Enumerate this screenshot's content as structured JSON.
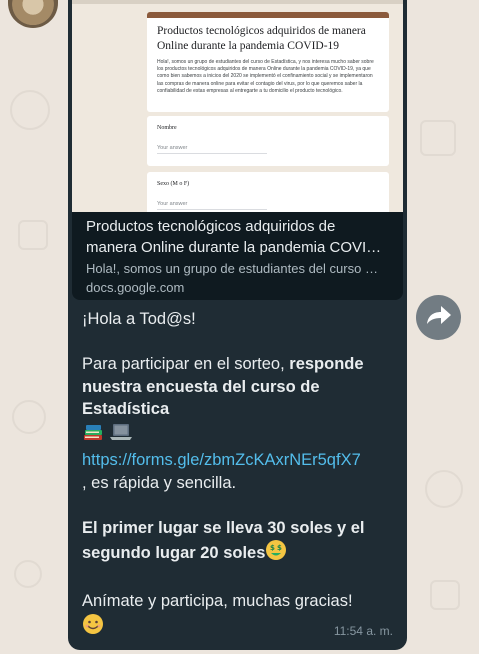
{
  "preview": {
    "form_title": "Productos tecnológicos adquiridos de manera Online durante la pandemia COVID-19",
    "form_description": "Hola!, somos un grupo de estudiantes del curso de Estadística, y nos interesa mucho saber sobre los productos tecnológicos adquiridos de manera Online durante la pandemia COVID-19, ya que como bien sabemos a inicios del 2020 se implementó el confinamiento social y se implementaron las compras de manera online para evitar el contagio del virus, por lo que queremos saber la confiabilidad de estas empresas al entregarte a tu domicilio el producto tecnológico.",
    "questions": [
      {
        "label": "Nombre",
        "answer_placeholder": "Your answer"
      },
      {
        "label": "Sexo (M o F)",
        "answer_placeholder": "Your answer"
      }
    ],
    "title_line1": "Productos tecnológicos adquiridos de",
    "title_line2": "manera Online durante la pandemia COVI…",
    "description": "Hola!, somos un grupo de estudiantes del curso …",
    "domain": "docs.google.com"
  },
  "message": {
    "greeting": "¡Hola a Tod@s!",
    "participate_prefix": "Para participar en el sorteo, ",
    "participate_bold": "responde nuestra encuesta del curso de Estadística",
    "link": "https://forms.gle/zbmZcKAxrNEr5qfX7",
    "link_suffix": ", es rápida y sencilla.",
    "prize": "El primer lugar se lleva 30 soles y el segundo lugar 20 soles",
    "closing": "Anímate y participa, muchas gracias!"
  },
  "timestamp": "11:54 a. m.",
  "icons": {
    "books": "books-emoji",
    "laptop": "laptop-emoji",
    "money_face": "money-mouth-face-emoji",
    "smile": "smiling-face-emoji",
    "forward": "forward-arrow-icon"
  },
  "colors": {
    "bubble": "#1f2c34",
    "link": "#53bdeb",
    "form_accent": "#8b5a3c",
    "wallpaper": "#ece5dd"
  }
}
